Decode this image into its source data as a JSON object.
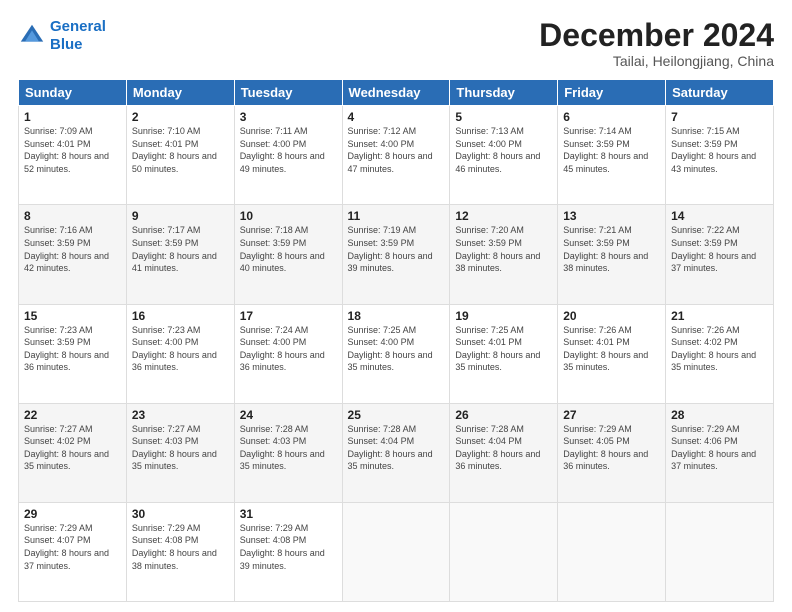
{
  "header": {
    "logo_line1": "General",
    "logo_line2": "Blue",
    "month": "December 2024",
    "location": "Tailai, Heilongjiang, China"
  },
  "days_of_week": [
    "Sunday",
    "Monday",
    "Tuesday",
    "Wednesday",
    "Thursday",
    "Friday",
    "Saturday"
  ],
  "weeks": [
    [
      {
        "num": "1",
        "sunrise": "7:09 AM",
        "sunset": "4:01 PM",
        "daylight": "8 hours and 52 minutes."
      },
      {
        "num": "2",
        "sunrise": "7:10 AM",
        "sunset": "4:01 PM",
        "daylight": "8 hours and 50 minutes."
      },
      {
        "num": "3",
        "sunrise": "7:11 AM",
        "sunset": "4:00 PM",
        "daylight": "8 hours and 49 minutes."
      },
      {
        "num": "4",
        "sunrise": "7:12 AM",
        "sunset": "4:00 PM",
        "daylight": "8 hours and 47 minutes."
      },
      {
        "num": "5",
        "sunrise": "7:13 AM",
        "sunset": "4:00 PM",
        "daylight": "8 hours and 46 minutes."
      },
      {
        "num": "6",
        "sunrise": "7:14 AM",
        "sunset": "3:59 PM",
        "daylight": "8 hours and 45 minutes."
      },
      {
        "num": "7",
        "sunrise": "7:15 AM",
        "sunset": "3:59 PM",
        "daylight": "8 hours and 43 minutes."
      }
    ],
    [
      {
        "num": "8",
        "sunrise": "7:16 AM",
        "sunset": "3:59 PM",
        "daylight": "8 hours and 42 minutes."
      },
      {
        "num": "9",
        "sunrise": "7:17 AM",
        "sunset": "3:59 PM",
        "daylight": "8 hours and 41 minutes."
      },
      {
        "num": "10",
        "sunrise": "7:18 AM",
        "sunset": "3:59 PM",
        "daylight": "8 hours and 40 minutes."
      },
      {
        "num": "11",
        "sunrise": "7:19 AM",
        "sunset": "3:59 PM",
        "daylight": "8 hours and 39 minutes."
      },
      {
        "num": "12",
        "sunrise": "7:20 AM",
        "sunset": "3:59 PM",
        "daylight": "8 hours and 38 minutes."
      },
      {
        "num": "13",
        "sunrise": "7:21 AM",
        "sunset": "3:59 PM",
        "daylight": "8 hours and 38 minutes."
      },
      {
        "num": "14",
        "sunrise": "7:22 AM",
        "sunset": "3:59 PM",
        "daylight": "8 hours and 37 minutes."
      }
    ],
    [
      {
        "num": "15",
        "sunrise": "7:23 AM",
        "sunset": "3:59 PM",
        "daylight": "8 hours and 36 minutes."
      },
      {
        "num": "16",
        "sunrise": "7:23 AM",
        "sunset": "4:00 PM",
        "daylight": "8 hours and 36 minutes."
      },
      {
        "num": "17",
        "sunrise": "7:24 AM",
        "sunset": "4:00 PM",
        "daylight": "8 hours and 36 minutes."
      },
      {
        "num": "18",
        "sunrise": "7:25 AM",
        "sunset": "4:00 PM",
        "daylight": "8 hours and 35 minutes."
      },
      {
        "num": "19",
        "sunrise": "7:25 AM",
        "sunset": "4:01 PM",
        "daylight": "8 hours and 35 minutes."
      },
      {
        "num": "20",
        "sunrise": "7:26 AM",
        "sunset": "4:01 PM",
        "daylight": "8 hours and 35 minutes."
      },
      {
        "num": "21",
        "sunrise": "7:26 AM",
        "sunset": "4:02 PM",
        "daylight": "8 hours and 35 minutes."
      }
    ],
    [
      {
        "num": "22",
        "sunrise": "7:27 AM",
        "sunset": "4:02 PM",
        "daylight": "8 hours and 35 minutes."
      },
      {
        "num": "23",
        "sunrise": "7:27 AM",
        "sunset": "4:03 PM",
        "daylight": "8 hours and 35 minutes."
      },
      {
        "num": "24",
        "sunrise": "7:28 AM",
        "sunset": "4:03 PM",
        "daylight": "8 hours and 35 minutes."
      },
      {
        "num": "25",
        "sunrise": "7:28 AM",
        "sunset": "4:04 PM",
        "daylight": "8 hours and 35 minutes."
      },
      {
        "num": "26",
        "sunrise": "7:28 AM",
        "sunset": "4:04 PM",
        "daylight": "8 hours and 36 minutes."
      },
      {
        "num": "27",
        "sunrise": "7:29 AM",
        "sunset": "4:05 PM",
        "daylight": "8 hours and 36 minutes."
      },
      {
        "num": "28",
        "sunrise": "7:29 AM",
        "sunset": "4:06 PM",
        "daylight": "8 hours and 37 minutes."
      }
    ],
    [
      {
        "num": "29",
        "sunrise": "7:29 AM",
        "sunset": "4:07 PM",
        "daylight": "8 hours and 37 minutes."
      },
      {
        "num": "30",
        "sunrise": "7:29 AM",
        "sunset": "4:08 PM",
        "daylight": "8 hours and 38 minutes."
      },
      {
        "num": "31",
        "sunrise": "7:29 AM",
        "sunset": "4:08 PM",
        "daylight": "8 hours and 39 minutes."
      },
      null,
      null,
      null,
      null
    ]
  ]
}
